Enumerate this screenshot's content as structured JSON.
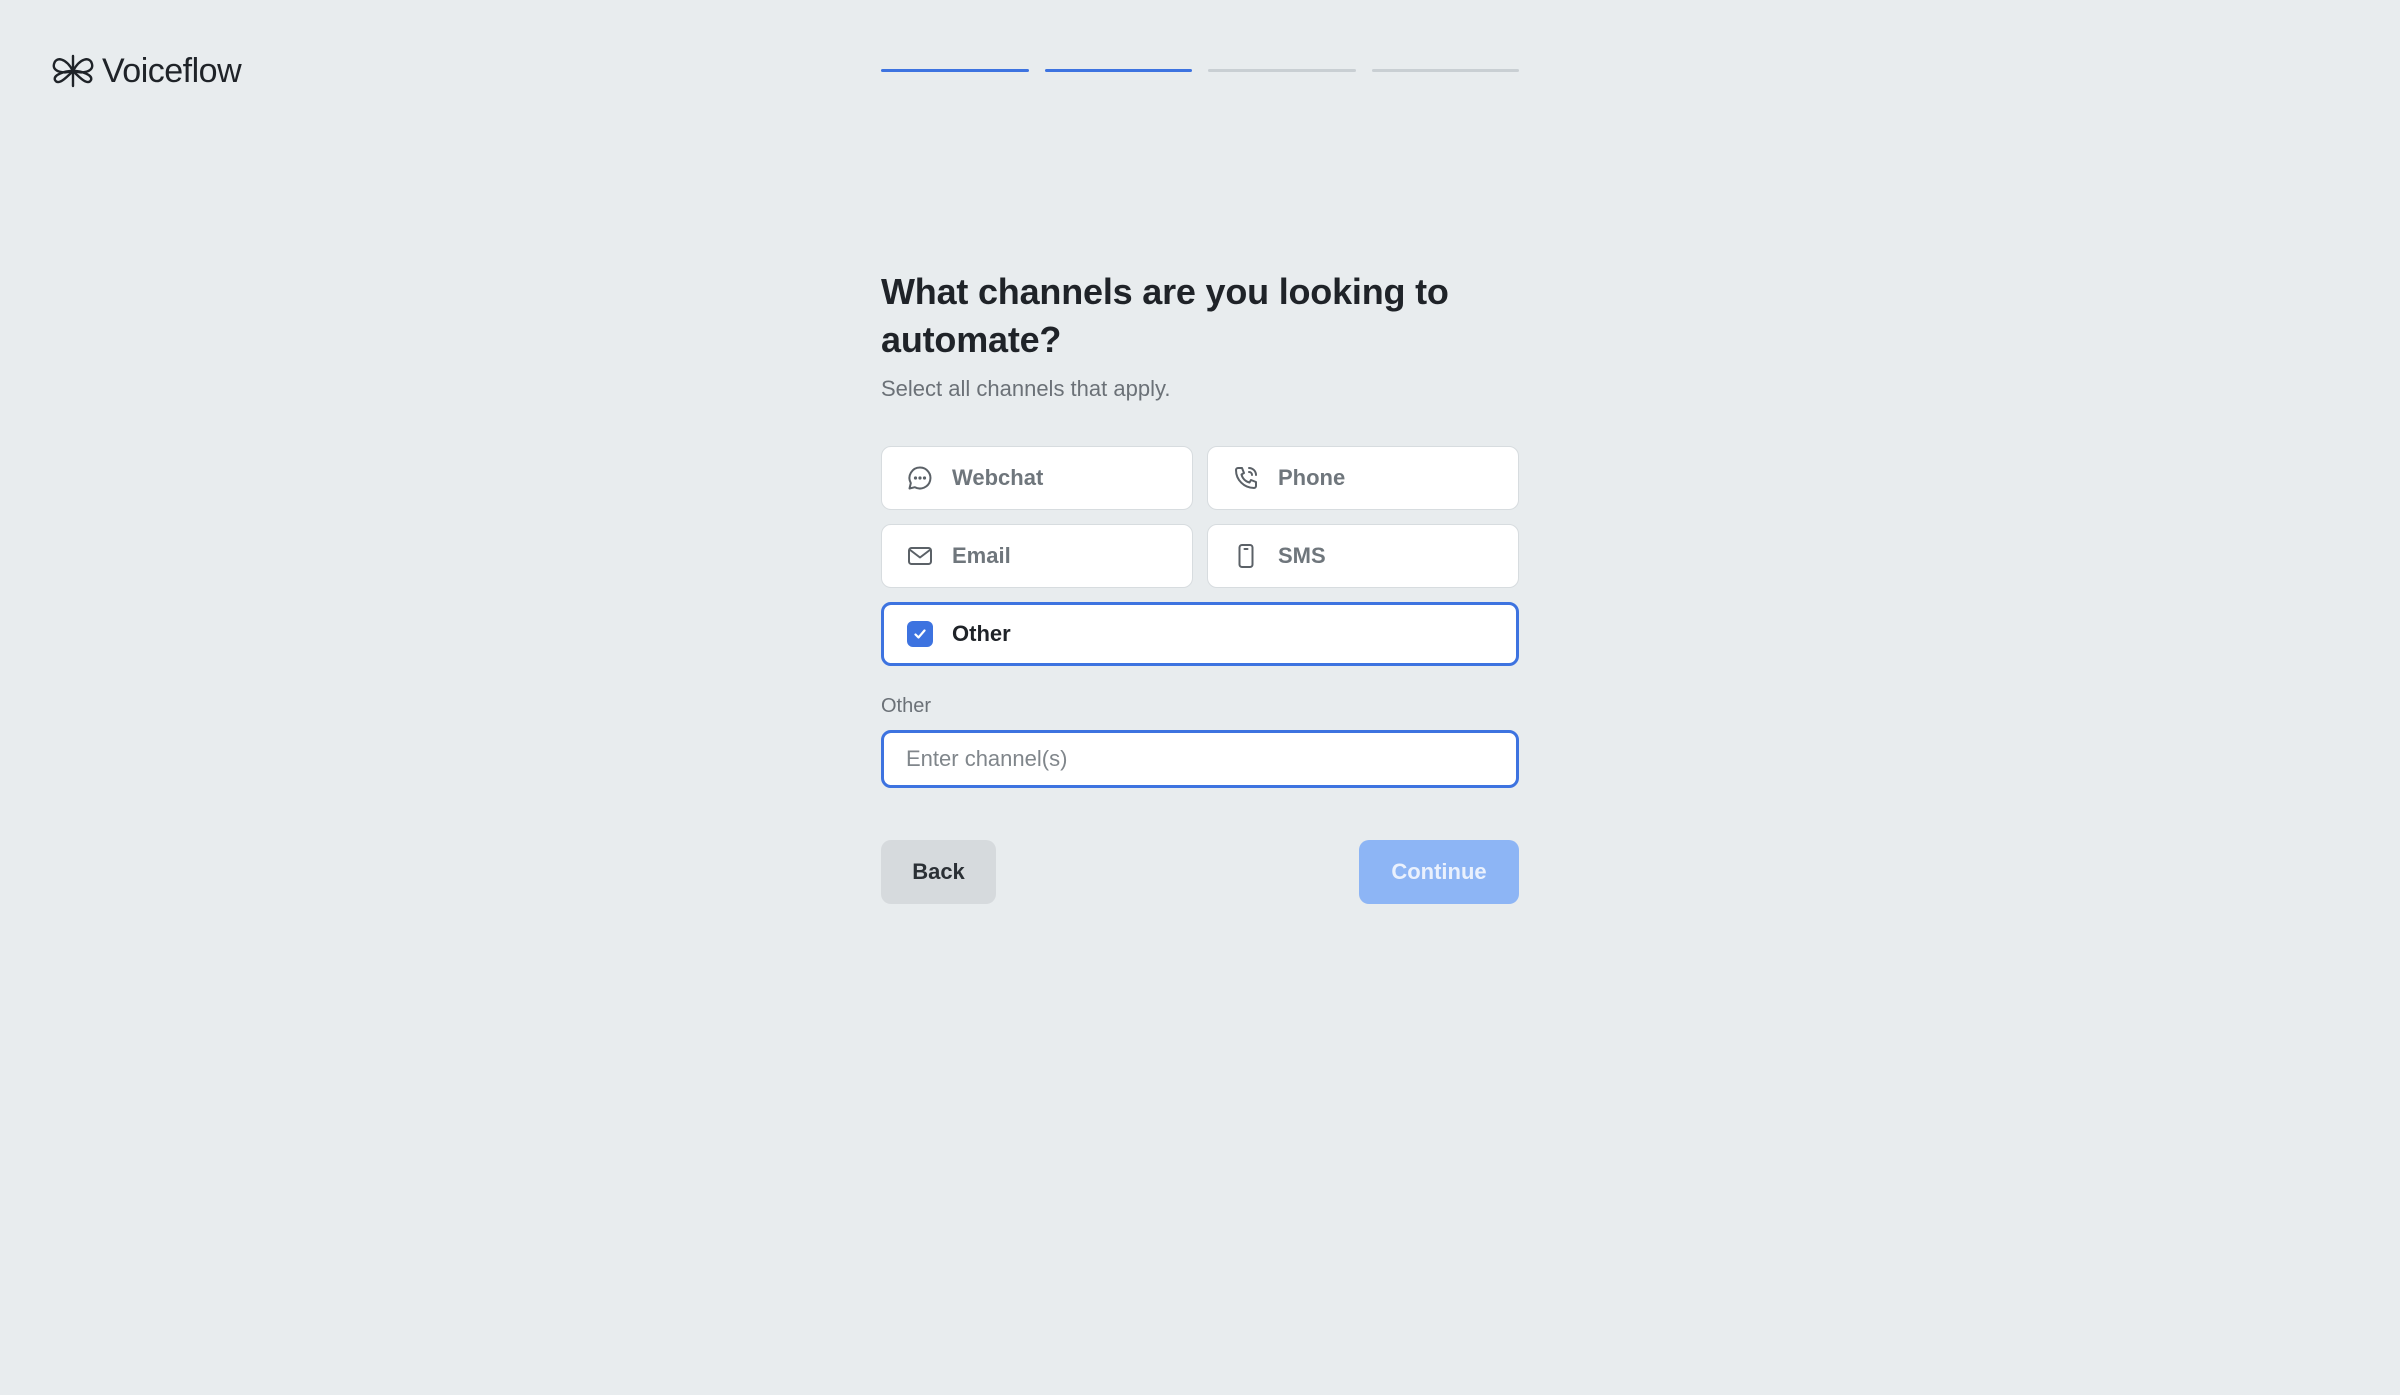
{
  "brand": {
    "name": "Voiceflow",
    "logo_icon": "voiceflow-logo-icon"
  },
  "progress": {
    "total_steps": 4,
    "completed_steps": 2
  },
  "question": {
    "title": "What channels are you looking to automate?",
    "subtitle": "Select all channels that apply."
  },
  "options": [
    {
      "label": "Webchat",
      "icon": "chat-bubble-icon",
      "selected": false
    },
    {
      "label": "Phone",
      "icon": "phone-icon",
      "selected": false
    },
    {
      "label": "Email",
      "icon": "envelope-icon",
      "selected": false
    },
    {
      "label": "SMS",
      "icon": "mobile-phone-icon",
      "selected": false
    },
    {
      "label": "Other",
      "icon": "checkbox-checked-icon",
      "selected": true
    }
  ],
  "other_field": {
    "label": "Other",
    "placeholder": "Enter channel(s)",
    "value": ""
  },
  "buttons": {
    "back": "Back",
    "continue": "Continue"
  },
  "colors": {
    "accent": "#3d73e0",
    "background": "#e8ecee",
    "continue_disabled": "#8db5f5"
  }
}
